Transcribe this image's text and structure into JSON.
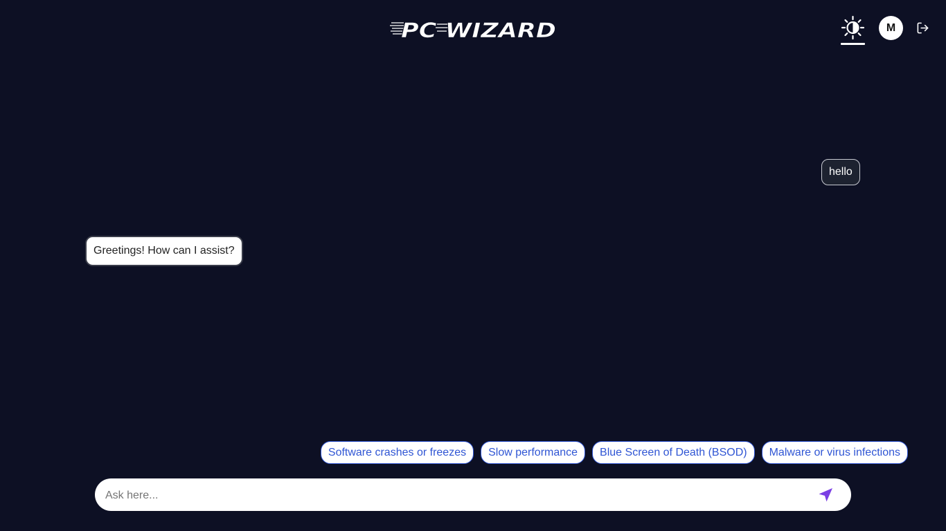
{
  "header": {
    "logo_text": "PC WIZARD",
    "logo_icon": "pc-wizard-logo",
    "theme_icon": "sun-moon-icon",
    "avatar_initial": "M",
    "logout_icon": "logout-icon"
  },
  "messages": [
    {
      "role": "user",
      "text": "hello"
    },
    {
      "role": "assistant",
      "text": "Greetings! How can I assist?"
    }
  ],
  "suggestions": [
    "Software crashes or freezes",
    "Slow performance",
    "Blue Screen of Death (BSOD)",
    "Malware or virus infections"
  ],
  "input": {
    "placeholder": "Ask here...",
    "value": "",
    "send_icon": "send-icon"
  },
  "colors": {
    "background": "#0d1024",
    "chip_accent": "#2f55d4",
    "send_accent": "#7b3fe4"
  }
}
